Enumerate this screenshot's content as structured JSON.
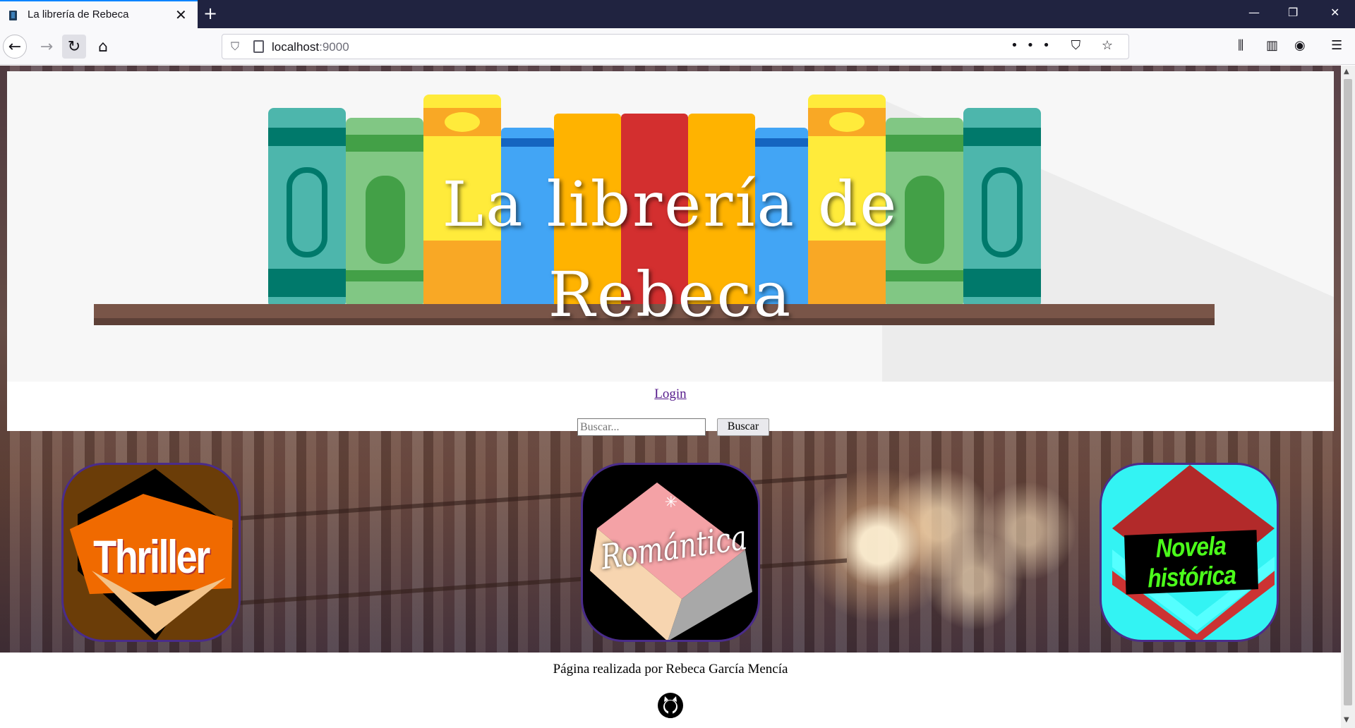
{
  "browser": {
    "tab_title": "La librería de Rebeca",
    "tab_close": "✕",
    "new_tab": "+",
    "url_host": "localhost",
    "url_port": ":9000",
    "url_actions": "••• ⛉ ☆",
    "window_controls": {
      "minimize": "—",
      "restore": "❐",
      "close": "✕"
    },
    "nav": {
      "back": "←",
      "forward": "→",
      "reload": "↻",
      "home": "⌂"
    },
    "toolbar": {
      "library": "⫼",
      "sidebar": "▥",
      "account": "◉",
      "menu": "☰"
    }
  },
  "header": {
    "banner_title_line1": "La librería de",
    "banner_title_line2": "Rebeca",
    "login_link": "Login",
    "search_placeholder": "Buscar...",
    "search_button": "Buscar"
  },
  "genres": [
    {
      "label": "Thriller",
      "colors": {
        "bg": "#6b3d08",
        "accent": "#f05a00"
      }
    },
    {
      "label": "Romántica",
      "colors": {
        "bg": "#000000",
        "accent": "#f4a2a6"
      }
    },
    {
      "label": "Novela histórica",
      "colors": {
        "bg": "#33f3f3",
        "accent": "#b22a2a"
      }
    }
  ],
  "footer": {
    "credit": "Página realizada por Rebeca García Mencía",
    "icon": "github-icon"
  },
  "colors": {
    "tabbar": "#202340",
    "link_visited": "#551a8b",
    "genre_border": "#4a2c8a"
  }
}
